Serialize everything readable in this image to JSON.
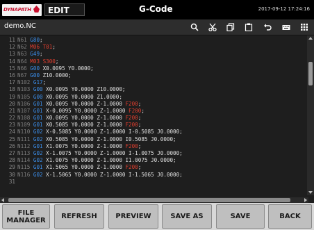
{
  "titlebar": {
    "logo_text": "DYNAPATH",
    "mode": "EDIT",
    "title": "G-Code",
    "datetime": "2017-09-12 17:24:16"
  },
  "filebar": {
    "filename": "demo.NC",
    "icons": [
      "search-icon",
      "scissors-icon",
      "copy-icon",
      "paste-icon",
      "undo-icon",
      "keyboard-icon",
      "grid-icon"
    ]
  },
  "code": {
    "lines": [
      {
        "ln": "11",
        "n": "N61",
        "rest": [
          {
            "c": "g",
            "t": "G80"
          },
          {
            "c": "tk",
            "t": ";"
          }
        ]
      },
      {
        "ln": "12",
        "n": "N62",
        "rest": [
          {
            "c": "m",
            "t": "M06"
          },
          {
            "c": "tk",
            "t": " "
          },
          {
            "c": "t",
            "t": "T01"
          },
          {
            "c": "tk",
            "t": ";"
          }
        ]
      },
      {
        "ln": "13",
        "n": "N63",
        "rest": [
          {
            "c": "g",
            "t": "G49"
          },
          {
            "c": "tk",
            "t": ";"
          }
        ]
      },
      {
        "ln": "14",
        "n": "N64",
        "rest": [
          {
            "c": "m",
            "t": "M03"
          },
          {
            "c": "tk",
            "t": " "
          },
          {
            "c": "s",
            "t": "S300"
          },
          {
            "c": "tk",
            "t": ";"
          }
        ]
      },
      {
        "ln": "15",
        "n": "N66",
        "rest": [
          {
            "c": "g",
            "t": "G00"
          },
          {
            "c": "tk",
            "t": " X0.0095 Y0.0000;"
          }
        ]
      },
      {
        "ln": "16",
        "n": "N67",
        "rest": [
          {
            "c": "g",
            "t": "G00"
          },
          {
            "c": "tk",
            "t": " Z10.0000;"
          }
        ]
      },
      {
        "ln": "17",
        "n": "N102",
        "rest": [
          {
            "c": "g",
            "t": "G17"
          },
          {
            "c": "tk",
            "t": ";"
          }
        ]
      },
      {
        "ln": "18",
        "n": "N103",
        "rest": [
          {
            "c": "g",
            "t": "G00"
          },
          {
            "c": "tk",
            "t": " X0.0095 Y0.0000 Z10.0000;"
          }
        ]
      },
      {
        "ln": "19",
        "n": "N105",
        "rest": [
          {
            "c": "g",
            "t": "G00"
          },
          {
            "c": "tk",
            "t": " X0.0095 Y0.0000 Z1.0000;"
          }
        ]
      },
      {
        "ln": "20",
        "n": "N106",
        "rest": [
          {
            "c": "g",
            "t": "G01"
          },
          {
            "c": "tk",
            "t": " X0.0095 Y0.0000 Z-1.0000 "
          },
          {
            "c": "f",
            "t": "F200"
          },
          {
            "c": "tk",
            "t": ";"
          }
        ]
      },
      {
        "ln": "21",
        "n": "N107",
        "rest": [
          {
            "c": "g",
            "t": "G01"
          },
          {
            "c": "tk",
            "t": " X-0.0095 Y0.0000 Z-1.0000 "
          },
          {
            "c": "f",
            "t": "F200"
          },
          {
            "c": "tk",
            "t": ";"
          }
        ]
      },
      {
        "ln": "22",
        "n": "N108",
        "rest": [
          {
            "c": "g",
            "t": "G01"
          },
          {
            "c": "tk",
            "t": " X0.0095 Y0.0000 Z-1.0000 "
          },
          {
            "c": "f",
            "t": "F200"
          },
          {
            "c": "tk",
            "t": ";"
          }
        ]
      },
      {
        "ln": "23",
        "n": "N109",
        "rest": [
          {
            "c": "g",
            "t": "G01"
          },
          {
            "c": "tk",
            "t": " X0.5085 Y0.0000 Z-1.0000 "
          },
          {
            "c": "f",
            "t": "F200"
          },
          {
            "c": "tk",
            "t": ";"
          }
        ]
      },
      {
        "ln": "24",
        "n": "N110",
        "rest": [
          {
            "c": "g",
            "t": "G02"
          },
          {
            "c": "tk",
            "t": " X-0.5085 Y0.0000 Z-1.0000 I-0.5085 J0.0000;"
          }
        ]
      },
      {
        "ln": "25",
        "n": "N111",
        "rest": [
          {
            "c": "g",
            "t": "G02"
          },
          {
            "c": "tk",
            "t": " X0.5085 Y0.0000 Z-1.0000 I0.5085 J0.0000;"
          }
        ]
      },
      {
        "ln": "26",
        "n": "N112",
        "rest": [
          {
            "c": "g",
            "t": "G01"
          },
          {
            "c": "tk",
            "t": " X1.0075 Y0.0000 Z-1.0000 "
          },
          {
            "c": "f",
            "t": "F200"
          },
          {
            "c": "tk",
            "t": ";"
          }
        ]
      },
      {
        "ln": "27",
        "n": "N113",
        "rest": [
          {
            "c": "g",
            "t": "G02"
          },
          {
            "c": "tk",
            "t": " X-1.0075 Y0.0000 Z-1.0000 I-1.0075 J0.0000;"
          }
        ]
      },
      {
        "ln": "28",
        "n": "N114",
        "rest": [
          {
            "c": "g",
            "t": "G02"
          },
          {
            "c": "tk",
            "t": " X1.0075 Y0.0000 Z-1.0000 I1.0075 J0.0000;"
          }
        ]
      },
      {
        "ln": "29",
        "n": "N115",
        "rest": [
          {
            "c": "g",
            "t": "G01"
          },
          {
            "c": "tk",
            "t": " X1.5065 Y0.0000 Z-1.0000 "
          },
          {
            "c": "f",
            "t": "F200"
          },
          {
            "c": "tk",
            "t": ";"
          }
        ]
      },
      {
        "ln": "30",
        "n": "N116",
        "rest": [
          {
            "c": "g",
            "t": "G02"
          },
          {
            "c": "tk",
            "t": " X-1.5065 Y0.0000 Z-1.0000 I-1.5065 J0.0000;"
          }
        ]
      },
      {
        "ln": "31",
        "n": "",
        "rest": []
      }
    ]
  },
  "softkeys": [
    "FILE\nMANAGER",
    "REFRESH",
    "PREVIEW",
    "SAVE AS",
    "SAVE",
    "BACK"
  ]
}
